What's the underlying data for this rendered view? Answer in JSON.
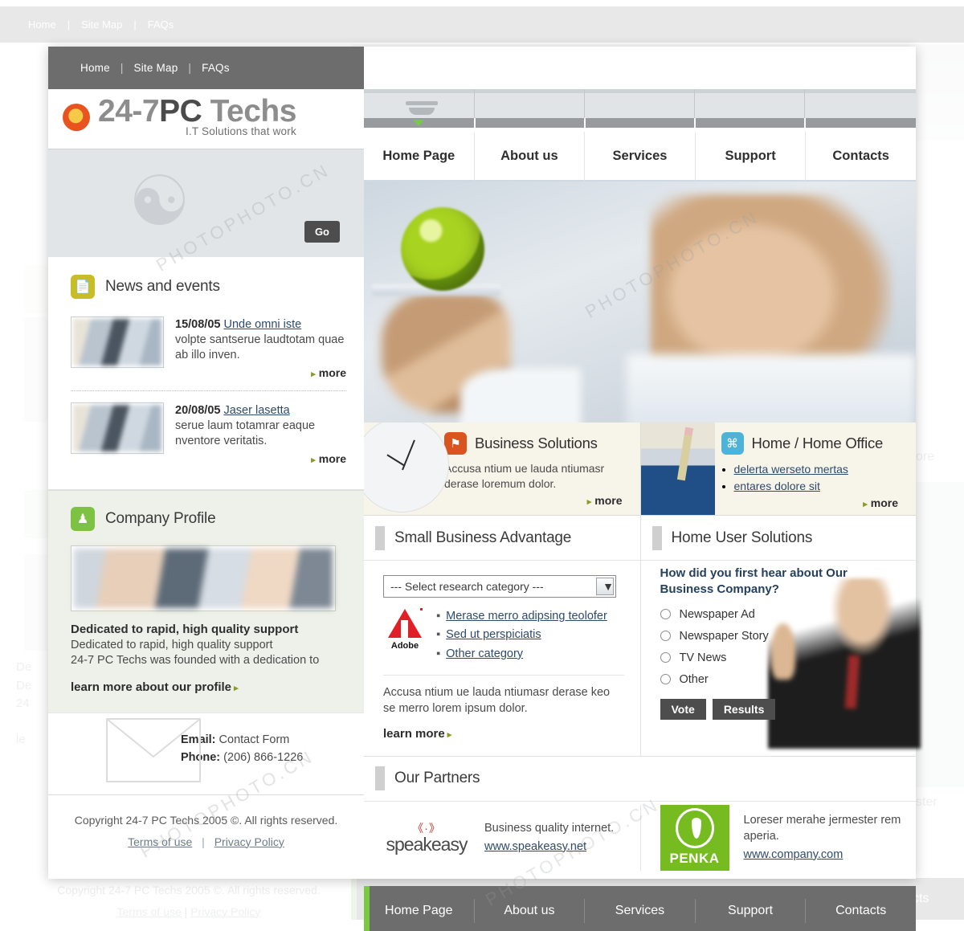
{
  "topbar": {
    "items": [
      "Home",
      "Site Map",
      "FAQs"
    ],
    "separator": "|"
  },
  "brand": {
    "title_part1": "24-7",
    "title_part2": "PC",
    "title_part3": "Techs",
    "tagline": "I.T Solutions that work",
    "logo_icon": "circle-logo-icon"
  },
  "search": {
    "placeholder": "",
    "value": "",
    "go_label": "Go"
  },
  "news": {
    "icon": "document-icon",
    "title": "News and events",
    "items": [
      {
        "date": "15/08/05",
        "link": "Unde omni iste",
        "text": "volpte santserue laudtotam quae ab illo inven.",
        "more": "more"
      },
      {
        "date": "20/08/05",
        "link": "Jaser lasetta",
        "text": "serue laum totamrar eaque nventore veritatis.",
        "more": "more"
      }
    ]
  },
  "profile": {
    "icon": "person-icon",
    "title": "Company Profile",
    "heading": "Dedicated to rapid, high quality support",
    "line1": "Dedicated to rapid, high quality support",
    "line2": "24-7 PC Techs was founded with a dedication to",
    "link": "learn more about our profile"
  },
  "contact": {
    "email_label": "Email:",
    "email_value": "Contact Form",
    "phone_label": "Phone:",
    "phone_value": "(206) 866-1226",
    "icon": "envelope-icon"
  },
  "copyright": {
    "text": "Copyright 24-7 PC Techs 2005 ©. All rights reserved.",
    "terms": "Terms of use",
    "pipe": "|",
    "privacy": "Privacy Policy"
  },
  "mainnav": {
    "items": [
      "Home Page",
      "About us",
      "Services",
      "Support",
      "Contacts"
    ],
    "active_index": 0
  },
  "hero": {
    "alt": "hand holding tray with green globe, businessman looking up"
  },
  "promos": [
    {
      "icon": "flag-icon",
      "icon_color": "#d9541e",
      "title": "Business Solutions",
      "text": "Accusa ntium ue lauda ntiumasr derase loremum dolor.",
      "links": [],
      "more": "more",
      "image": "clock-image"
    },
    {
      "icon": "command-icon",
      "icon_color": "#4eb3d9",
      "title": "Home / Home Office",
      "text": "",
      "links": [
        "delerta werseto mertas",
        "entares dolore sit"
      ],
      "more": "more",
      "image": "books-pencil-image"
    }
  ],
  "small_business": {
    "title": "Small Business Advantage",
    "select_value": "--- Select research category ---",
    "select_icon": "chevron-down-icon",
    "partner_logo": "adobe-logo",
    "partner_word": "Adobe",
    "links": [
      "Merase merro adipsing teolofer",
      "Sed ut perspiciatis",
      "Other category"
    ],
    "note": "Accusa ntium ue lauda ntiumasr derase keo se merro lorem ipsum dolor.",
    "more": "learn more"
  },
  "poll": {
    "title": "Home User Solutions",
    "question": "How did you first hear about Our Business Company?",
    "options": [
      "Newspaper Ad",
      "Newspaper Story",
      "TV News",
      "Other"
    ],
    "vote_label": "Vote",
    "results_label": "Results",
    "image": "businessman-image"
  },
  "partners": {
    "title": "Our Partners",
    "items": [
      {
        "logo": "speakeasy-logo",
        "logo_waves": "《·》",
        "logo_word": "speakeasy",
        "text": "Business quality internet.",
        "url": "www.speakeasy.net"
      },
      {
        "logo": "penka-logo",
        "logo_word": "PENKA",
        "text": "Loreser merahe jermester rem aperia.",
        "url": "www.company.com"
      }
    ]
  },
  "footnav": {
    "items": [
      "Home Page",
      "About us",
      "Services",
      "Support",
      "Contacts"
    ]
  },
  "colors": {
    "topbar_grey": "#6d6d6d",
    "accent_green": "#7ac943",
    "news_yellow": "#c9bd26",
    "profile_green": "#7dc242",
    "business_orange": "#d9541e",
    "home_blue": "#4eb3d9",
    "link_blue": "#2e4a6b",
    "penka_green": "#76bc21",
    "adobe_red": "#e01f26"
  },
  "watermark": {
    "text": "PHOTOPHOTO.CN"
  }
}
